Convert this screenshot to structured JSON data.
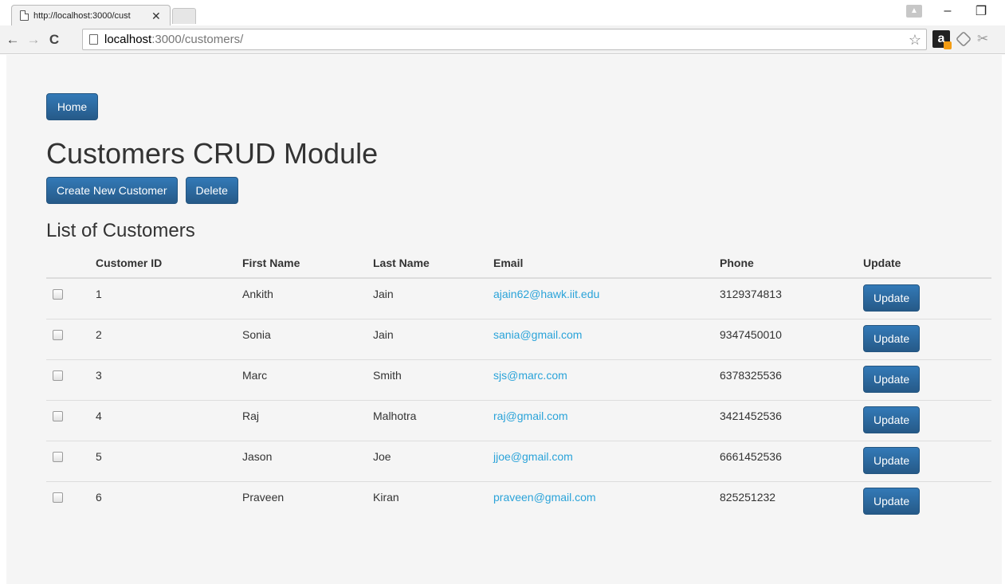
{
  "browser": {
    "tab_title": "http://localhost:3000/cust",
    "tab_close": "✕",
    "url_host": "localhost",
    "url_rest": ":3000/customers/",
    "back": "←",
    "forward": "→",
    "reload": "C",
    "star": "☆",
    "ext_amazon": "a",
    "ext_tool": "✂",
    "minimize": "–",
    "restore": "❐",
    "profile": "▲"
  },
  "page": {
    "home_label": "Home",
    "title": "Customers CRUD Module",
    "create_label": "Create New Customer",
    "delete_label": "Delete",
    "list_heading": "List of Customers"
  },
  "table": {
    "headers": [
      "",
      "Customer ID",
      "First Name",
      "Last Name",
      "Email",
      "Phone",
      "Update"
    ],
    "update_label": "Update",
    "rows": [
      {
        "id": "1",
        "first": "Ankith",
        "last": "Jain",
        "email": "ajain62@hawk.iit.edu",
        "phone": "3129374813"
      },
      {
        "id": "2",
        "first": "Sonia",
        "last": "Jain",
        "email": "sania@gmail.com",
        "phone": "9347450010"
      },
      {
        "id": "3",
        "first": "Marc",
        "last": "Smith",
        "email": "sjs@marc.com",
        "phone": "6378325536"
      },
      {
        "id": "4",
        "first": "Raj",
        "last": "Malhotra",
        "email": "raj@gmail.com",
        "phone": "3421452536"
      },
      {
        "id": "5",
        "first": "Jason",
        "last": "Joe",
        "email": "jjoe@gmail.com",
        "phone": "6661452536"
      },
      {
        "id": "6",
        "first": "Praveen",
        "last": "Kiran",
        "email": "praveen@gmail.com",
        "phone": "825251232"
      }
    ]
  },
  "colors": {
    "button": "#337ab7",
    "link": "#2aa3d9",
    "page_bg": "#f5f5f5"
  }
}
